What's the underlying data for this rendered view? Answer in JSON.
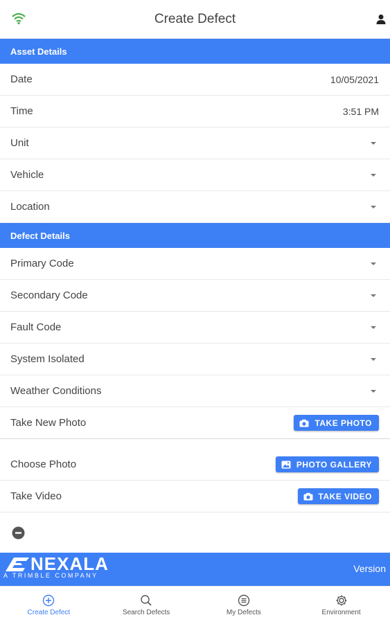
{
  "header": {
    "title": "Create Defect",
    "wifi_icon": "wifi-icon",
    "user_icon": "user-icon",
    "wifi_color": "#4caf50"
  },
  "sections": {
    "asset": "Asset Details",
    "defect": "Defect Details"
  },
  "asset_rows": {
    "date": {
      "label": "Date",
      "value": "10/05/2021"
    },
    "time": {
      "label": "Time",
      "value": "3:51 PM"
    },
    "unit": {
      "label": "Unit"
    },
    "vehicle": {
      "label": "Vehicle"
    },
    "location": {
      "label": "Location"
    }
  },
  "defect_rows": {
    "primary": {
      "label": "Primary Code"
    },
    "secondary": {
      "label": "Secondary Code"
    },
    "fault": {
      "label": "Fault Code"
    },
    "system": {
      "label": "System Isolated"
    },
    "weather": {
      "label": "Weather Conditions"
    }
  },
  "media_rows": {
    "photo": {
      "label": "Take New Photo",
      "button": "TAKE PHOTO"
    },
    "gallery": {
      "label": "Choose Photo",
      "button": "PHOTO GALLERY"
    },
    "video": {
      "label": "Take Video",
      "button": "TAKE VIDEO"
    }
  },
  "brand": {
    "name": "NEXALA",
    "subtitle": "A TRIMBLE COMPANY",
    "version_label": "Version"
  },
  "nav": {
    "items": [
      {
        "label": "Create Defect",
        "icon": "plus-circle-icon",
        "active": true
      },
      {
        "label": "Search Defects",
        "icon": "search-icon",
        "active": false
      },
      {
        "label": "My Defects",
        "icon": "list-circle-icon",
        "active": false
      },
      {
        "label": "Environment",
        "icon": "gear-icon",
        "active": false
      }
    ]
  },
  "colors": {
    "accent": "#3d7ff5",
    "wifi": "#4caf50"
  }
}
